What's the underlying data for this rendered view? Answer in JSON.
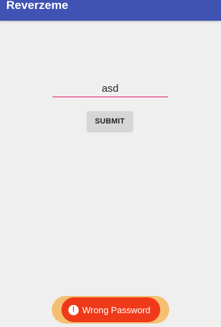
{
  "app_bar": {
    "title": "Reverzeme",
    "color": "#4052b2"
  },
  "form": {
    "input_value": "asd",
    "submit_label": "SUBMIT",
    "accent_color": "#e2186f"
  },
  "toast": {
    "icon": "alert-icon",
    "icon_glyph": "!",
    "message": "Wrong Password",
    "background": "#ef3a1a",
    "halo_color": "#f6b65a"
  }
}
